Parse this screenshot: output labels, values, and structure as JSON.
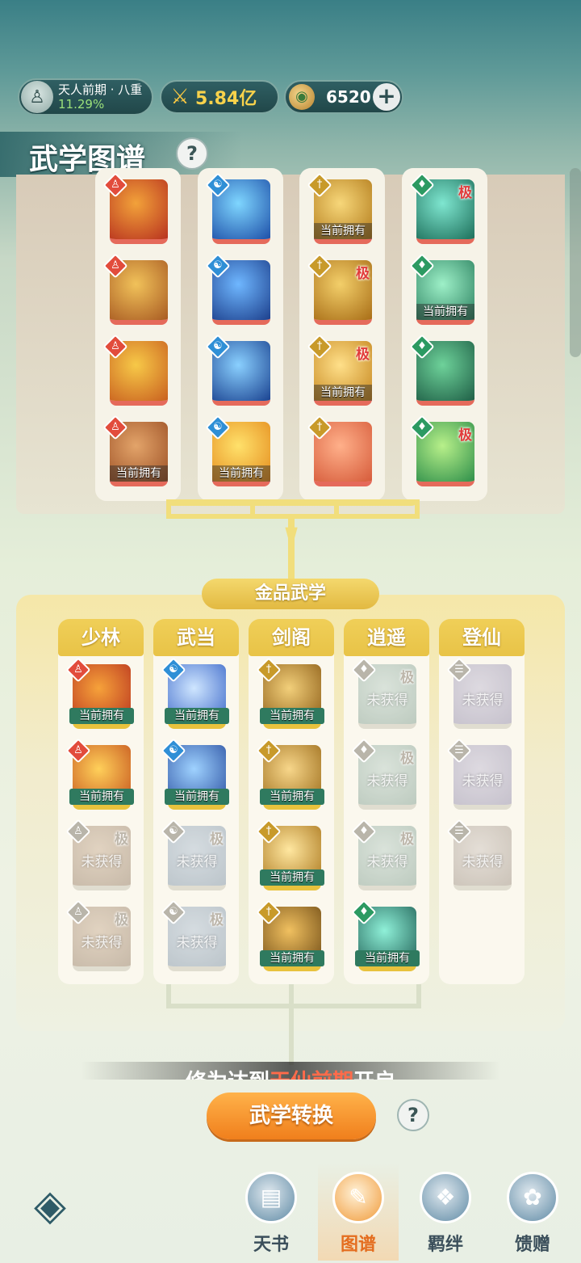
{
  "header": {
    "realm_name": "天人前期 · 八重",
    "realm_progress": "11.29%",
    "combat_power": "5.84亿",
    "currency_amount": "6520",
    "add_label": "+"
  },
  "page": {
    "title": "武学图谱",
    "help_label": "?"
  },
  "labels": {
    "owned": "当前拥有",
    "not_owned": "未获得",
    "extreme": "极"
  },
  "red_tier": {
    "columns": [
      {
        "badge_color": "#e24c3c",
        "cards": [
          {
            "owned": false,
            "extreme": false,
            "art": [
              "#f2a23a",
              "#b8321f"
            ]
          },
          {
            "owned": false,
            "extreme": false,
            "art": [
              "#f1c25a",
              "#a85a22"
            ]
          },
          {
            "owned": false,
            "extreme": false,
            "art": [
              "#f7c948",
              "#c9601f"
            ]
          },
          {
            "owned": true,
            "extreme": false,
            "art": [
              "#e3a46a",
              "#9b4f24"
            ]
          }
        ]
      },
      {
        "badge_color": "#2f8fd6",
        "cards": [
          {
            "owned": false,
            "extreme": false,
            "art": [
              "#7fd6ff",
              "#1d4fa8"
            ]
          },
          {
            "owned": false,
            "extreme": false,
            "art": [
              "#6fb7ff",
              "#1c3f8c"
            ]
          },
          {
            "owned": false,
            "extreme": false,
            "art": [
              "#8ad0ff",
              "#1a4290"
            ]
          },
          {
            "owned": true,
            "extreme": false,
            "art": [
              "#ffe16b",
              "#e48a1c"
            ]
          }
        ]
      },
      {
        "badge_color": "#c89a2a",
        "cards": [
          {
            "owned": true,
            "extreme": false,
            "art": [
              "#f7d77a",
              "#b07818"
            ]
          },
          {
            "owned": false,
            "extreme": true,
            "art": [
              "#f3cf6a",
              "#a86d16"
            ]
          },
          {
            "owned": true,
            "extreme": true,
            "art": [
              "#ffe08a",
              "#c4841c"
            ]
          },
          {
            "owned": false,
            "extreme": false,
            "art": [
              "#ffb08a",
              "#d65b3a"
            ]
          }
        ]
      },
      {
        "badge_color": "#2c9a62",
        "cards": [
          {
            "owned": false,
            "extreme": true,
            "art": [
              "#7fe6d0",
              "#1d6f5a"
            ]
          },
          {
            "owned": true,
            "extreme": false,
            "art": [
              "#9ef0c8",
              "#2a7f5e"
            ]
          },
          {
            "owned": false,
            "extreme": false,
            "art": [
              "#6ed29a",
              "#1f5f46"
            ]
          },
          {
            "owned": false,
            "extreme": true,
            "art": [
              "#b8f08a",
              "#2e8f4a"
            ]
          }
        ]
      }
    ]
  },
  "gold_tier": {
    "title": "金品武学",
    "columns": [
      {
        "name": "少林",
        "badge_color": "#e24c3c",
        "cards": [
          {
            "owned": true,
            "extreme": false,
            "art": [
              "#f6a23a",
              "#b8321f"
            ]
          },
          {
            "owned": true,
            "extreme": false,
            "art": [
              "#ffd05a",
              "#c4511c"
            ]
          },
          {
            "owned": false,
            "extreme": true,
            "art": [
              "#d9c7b2",
              "#b6a592"
            ]
          },
          {
            "owned": false,
            "extreme": true,
            "art": [
              "#d9c7b2",
              "#b6a592"
            ]
          }
        ]
      },
      {
        "name": "武当",
        "badge_color": "#2f8fd6",
        "cards": [
          {
            "owned": true,
            "extreme": false,
            "art": [
              "#cfe6ff",
              "#3a66c8"
            ]
          },
          {
            "owned": true,
            "extreme": false,
            "art": [
              "#9fd2ff",
              "#2a4fa0"
            ]
          },
          {
            "owned": false,
            "extreme": true,
            "art": [
              "#c9d3dc",
              "#a7b4bf"
            ]
          },
          {
            "owned": false,
            "extreme": true,
            "art": [
              "#c9d3dc",
              "#a7b4bf"
            ]
          }
        ]
      },
      {
        "name": "剑阁",
        "badge_color": "#c89a2a",
        "cards": [
          {
            "owned": true,
            "extreme": false,
            "art": [
              "#f2cf7a",
              "#8a5a14"
            ]
          },
          {
            "owned": true,
            "extreme": false,
            "art": [
              "#f7d68a",
              "#9a6a18"
            ]
          },
          {
            "owned": true,
            "extreme": false,
            "art": [
              "#ffe7a0",
              "#a8741a"
            ]
          },
          {
            "owned": true,
            "extreme": false,
            "art": [
              "#f0c060",
              "#6e4a14"
            ]
          }
        ]
      },
      {
        "name": "逍遥",
        "badge_color": "#2c9a62",
        "cards": [
          {
            "owned": false,
            "extreme": true,
            "art": [
              "#cfdcd4",
              "#a9bcb0"
            ]
          },
          {
            "owned": false,
            "extreme": true,
            "art": [
              "#cfdcd4",
              "#a9bcb0"
            ]
          },
          {
            "owned": false,
            "extreme": true,
            "art": [
              "#cfdcd4",
              "#a9bcb0"
            ]
          },
          {
            "owned": true,
            "extreme": false,
            "art": [
              "#8ff0d8",
              "#1f5f54"
            ]
          }
        ]
      },
      {
        "name": "登仙",
        "badge_color": "#8a6fb8",
        "cards": [
          {
            "owned": false,
            "extreme": false,
            "art": [
              "#d4d0dc",
              "#b5b0c2"
            ]
          },
          {
            "owned": false,
            "extreme": false,
            "art": [
              "#d4d0dc",
              "#b5b0c2"
            ]
          },
          {
            "owned": false,
            "extreme": false,
            "art": [
              "#ddd6cf",
              "#bcb2a7"
            ]
          }
        ]
      }
    ]
  },
  "notice": {
    "prefix": "修为达到",
    "highlight": "天仙前期",
    "suffix": "开启"
  },
  "actions": {
    "convert_label": "武学转换",
    "help_label": "?"
  },
  "nav": {
    "items": [
      {
        "label": "天书",
        "icon": "book-icon",
        "active": false
      },
      {
        "label": "图谱",
        "icon": "scroll-icon",
        "active": true
      },
      {
        "label": "羁绊",
        "icon": "handshake-icon",
        "active": false
      },
      {
        "label": "馈赠",
        "icon": "gift-icon",
        "active": false
      }
    ]
  },
  "colors": {
    "red_tier_border": "#e56a5b",
    "gold_tier_border": "#e8c23d",
    "accent_orange": "#f07f1c"
  }
}
